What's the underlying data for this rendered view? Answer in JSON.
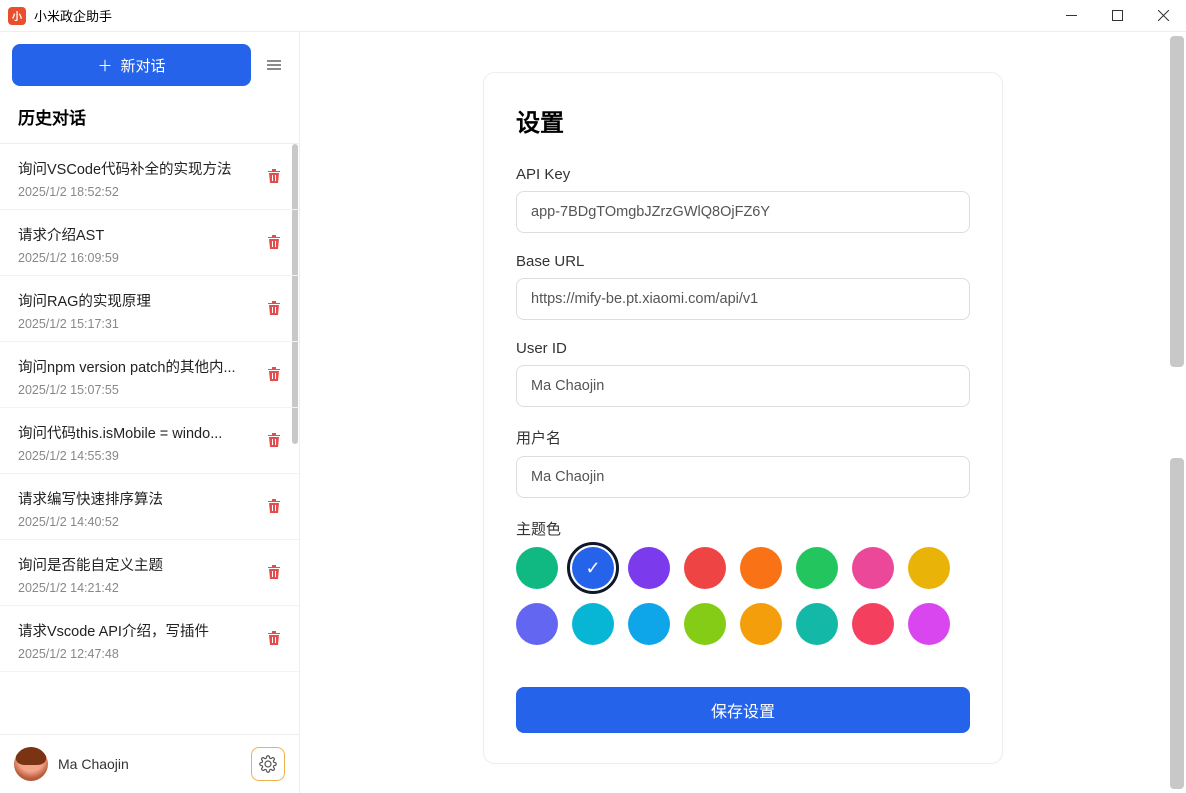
{
  "window": {
    "title": "小米政企助手"
  },
  "sidebar": {
    "new_chat_label": "新对话",
    "history_label": "历史对话",
    "items": [
      {
        "title": "询问VSCode代码补全的实现方法",
        "time": "2025/1/2 18:52:52"
      },
      {
        "title": "请求介绍AST",
        "time": "2025/1/2 16:09:59"
      },
      {
        "title": "询问RAG的实现原理",
        "time": "2025/1/2 15:17:31"
      },
      {
        "title": "询问npm version patch的其他内...",
        "time": "2025/1/2 15:07:55"
      },
      {
        "title": "询问代码this.isMobile = windo...",
        "time": "2025/1/2 14:55:39"
      },
      {
        "title": "请求编写快速排序算法",
        "time": "2025/1/2 14:40:52"
      },
      {
        "title": "询问是否能自定义主题",
        "time": "2025/1/2 14:21:42"
      },
      {
        "title": "请求Vscode API介绍，写插件",
        "time": "2025/1/2 12:47:48"
      }
    ],
    "footer_user": "Ma Chaojin"
  },
  "settings": {
    "title": "设置",
    "api_key_label": "API Key",
    "api_key_value": "app-7BDgTOmgbJZrzGWlQ8OjFZ6Y",
    "base_url_label": "Base URL",
    "base_url_value": "https://mify-be.pt.xiaomi.com/api/v1",
    "user_id_label": "User ID",
    "user_id_value": "Ma Chaojin",
    "username_label": "用户名",
    "username_value": "Ma Chaojin",
    "theme_label": "主题色",
    "colors": [
      "#10b981",
      "#2563eb",
      "#7c3aed",
      "#ef4444",
      "#f97316",
      "#22c55e",
      "#ec4899",
      "#eab308",
      "#6366f1",
      "#06b6d4",
      "#0ea5e9",
      "#84cc16",
      "#f59e0b",
      "#14b8a6",
      "#f43f5e",
      "#d946ef"
    ],
    "selected_color_index": 1,
    "save_label": "保存设置"
  }
}
